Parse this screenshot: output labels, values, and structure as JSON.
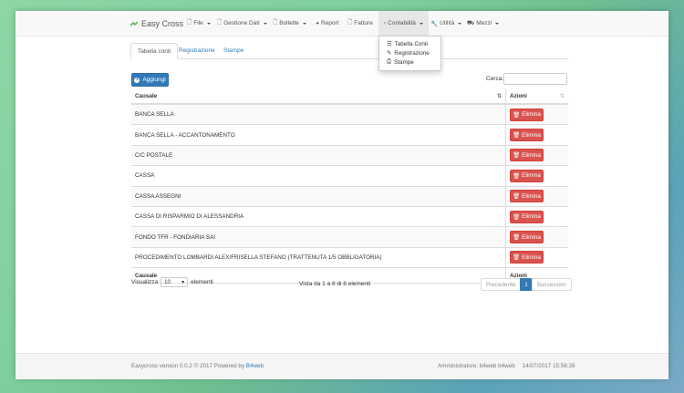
{
  "app": {
    "brand": "Easy Cross",
    "brand_color": "#5cb85c"
  },
  "nav": [
    {
      "label": "File",
      "icon": "file-icon"
    },
    {
      "label": "Gestione Dati",
      "icon": "document-icon"
    },
    {
      "label": "Bollette",
      "icon": "document-icon"
    },
    {
      "label": "Report",
      "icon": "report-icon"
    },
    {
      "label": "Fatture",
      "icon": "document-icon"
    },
    {
      "label": "Contabilità",
      "icon": "chevron-left-icon"
    },
    {
      "label": "Utilità",
      "icon": "wrench-icon"
    },
    {
      "label": "Mezzi",
      "icon": "truck-icon"
    }
  ],
  "dropdown": {
    "items": [
      {
        "label": "Tabella Conti",
        "icon": "list-icon"
      },
      {
        "label": "Registrazione",
        "icon": "pencil-icon"
      },
      {
        "label": "Stampe",
        "icon": "print-icon"
      }
    ]
  },
  "tabs": [
    {
      "label": "Tabella conti"
    },
    {
      "label": "Registrazione"
    },
    {
      "label": "Stampe"
    }
  ],
  "toolbar": {
    "add_label": "Aggiungi",
    "search_label": "Cerca:",
    "search_value": ""
  },
  "table": {
    "headers": [
      "Causale",
      "Azioni"
    ],
    "delete_label": "Elimina",
    "rows": [
      "BANCA SELLA",
      "BANCA SELLA - ACCANTONAMENTO",
      "C/C POSTALE",
      "CASSA",
      "CASSA ASSEGNI",
      "CASSA DI RISPARMIO DI ALESSANDRIA",
      "FONDO TFR - FONDIARIA SAI",
      "PROCEDIMENTO LOMBARDI ALEX/FRISELLA STEFANO (TRATTENUTA 1/5 OBBLIGATORIA)"
    ]
  },
  "length": {
    "prefix": "Visualizza",
    "value": "10",
    "suffix": "elementi"
  },
  "info": "Vista da 1 a 8 di 8 elementi",
  "pager": {
    "prev": "Precedente",
    "current": "1",
    "next": "Successivo"
  },
  "footer": {
    "left_text": "Easycross version 0.0.2 © 2017 Powered by ",
    "left_link": "B4web",
    "user": "Amministratore: b4web b4web",
    "datetime": "14/07/2017 15:56:26"
  },
  "colors": {
    "primary": "#337ab7",
    "danger": "#d9534f"
  }
}
